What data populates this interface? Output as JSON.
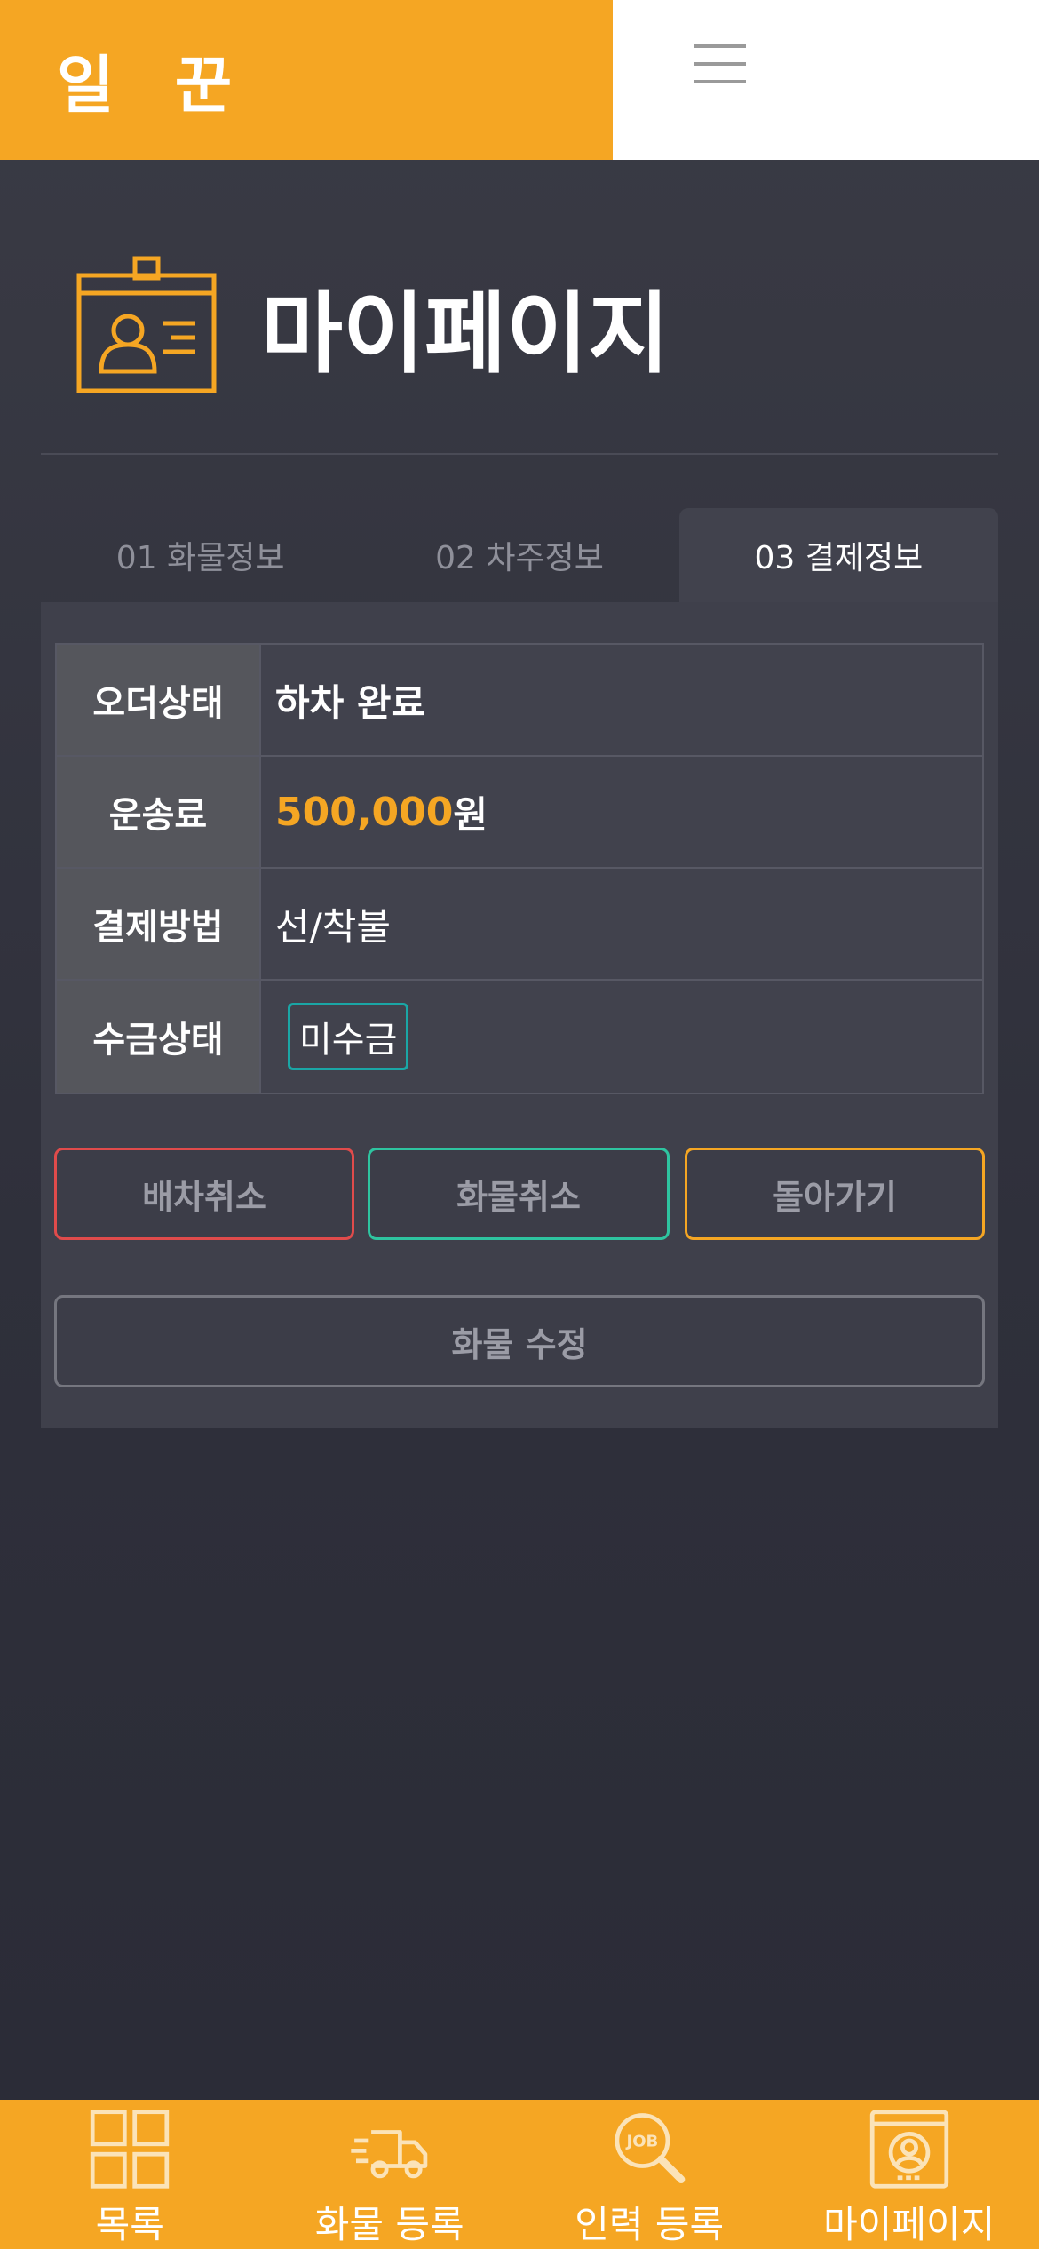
{
  "header": {
    "brand": "일 꾼",
    "menu_icon": "hamburger-icon"
  },
  "page": {
    "title": "마이페이지",
    "title_icon": "id-card-icon"
  },
  "tabs": [
    {
      "label": "01 화물정보",
      "active": false
    },
    {
      "label": "02 차주정보",
      "active": false
    },
    {
      "label": "03 결제정보",
      "active": true
    }
  ],
  "payment": {
    "order_status_label": "오더상태",
    "order_status_value": "하차 완료",
    "fee_label": "운송료",
    "fee_amount": "500,000",
    "fee_unit": "원",
    "method_label": "결제방법",
    "method_value": "선/착불",
    "collection_label": "수금상태",
    "collection_value": "미수금"
  },
  "actions": {
    "cancel_dispatch": "배차취소",
    "cancel_cargo": "화물취소",
    "go_back": "돌아가기",
    "edit_cargo": "화물 수정"
  },
  "bottom_nav": {
    "items": [
      {
        "label": "목록",
        "icon": "grid-icon"
      },
      {
        "label": "화물 등록",
        "icon": "truck-icon"
      },
      {
        "label": "인력 등록",
        "icon": "job-search-icon"
      },
      {
        "label": "마이페이지",
        "icon": "profile-icon"
      }
    ]
  },
  "colors": {
    "accent": "#f5a623",
    "background": "#32333e",
    "danger": "#e04b4b",
    "success": "#2ec4a0",
    "badge_border": "#1aa6a6"
  }
}
